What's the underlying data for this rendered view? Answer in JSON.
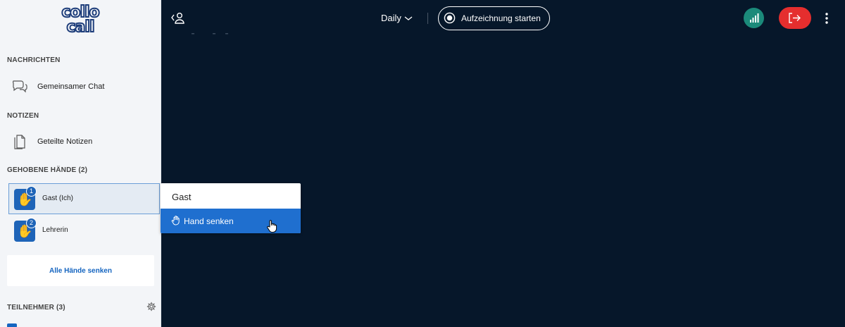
{
  "brand": {
    "logo_line1": "collo",
    "logo_line2": "call"
  },
  "sidebar": {
    "messages_title": "NACHRICHTEN",
    "chat_label": "Gemeinsamer Chat",
    "notes_title": "NOTIZEN",
    "notes_label": "Geteilte Notizen",
    "raised_hands_title": "GEHOBENE HÄNDE (2)",
    "raised_hands": [
      {
        "name": "Gast (Ich)",
        "order": "1",
        "selected": true
      },
      {
        "name": "Lehrerin",
        "order": "2",
        "selected": false
      }
    ],
    "lower_all_label": "Alle Hände senken",
    "participants_title": "TEILNEHMER (3)"
  },
  "topbar": {
    "room_title": "Daily",
    "record_label": "Aufzeichnung starten"
  },
  "context_menu": {
    "header": "Gast",
    "item_label": "Hand senken"
  },
  "icons": {
    "chat": "speech-bubbles-icon",
    "notes": "document-icon",
    "hand": "raised-hand-icon",
    "gear": "gear-icon",
    "user_toggle": "user-panel-toggle-icon",
    "chevron": "chevron-down-icon",
    "record": "record-icon",
    "signal": "signal-strength-icon",
    "leave": "exit-icon",
    "kebab": "more-vertical-icon",
    "cursor": "hand-pointer-cursor-icon"
  },
  "colors": {
    "stage_bg": "#06172a",
    "sidebar_bg": "#f3f5f8",
    "accent_blue": "#1f6fcf",
    "leave_red": "#e52e2e",
    "signal_green": "#1b8a7a",
    "hand_yellow": "#f7c531"
  }
}
